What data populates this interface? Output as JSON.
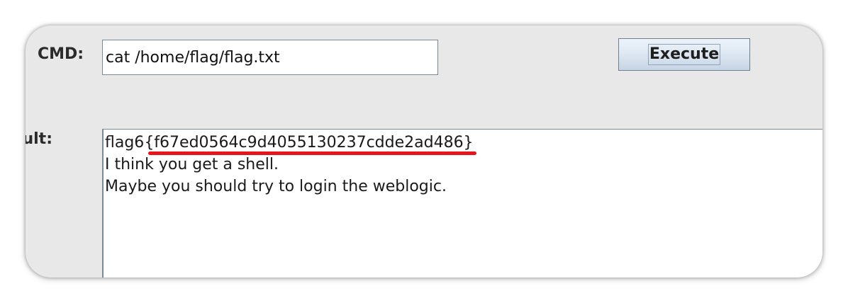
{
  "form": {
    "cmd_label": "CMD:",
    "cmd_value": "cat /home/flag/flag.txt",
    "execute_label": "Execute",
    "result_label": "Result:"
  },
  "result": {
    "flag_prefix": "flag6",
    "flag_value": "{f67ed0564c9d4055130237cdde2ad486}",
    "line2": "I think you get a shell.",
    "line3": "Maybe you should try to login the weblogic."
  },
  "colors": {
    "annotation_underline": "#e8141a",
    "window_background": "#e8e8e8"
  }
}
